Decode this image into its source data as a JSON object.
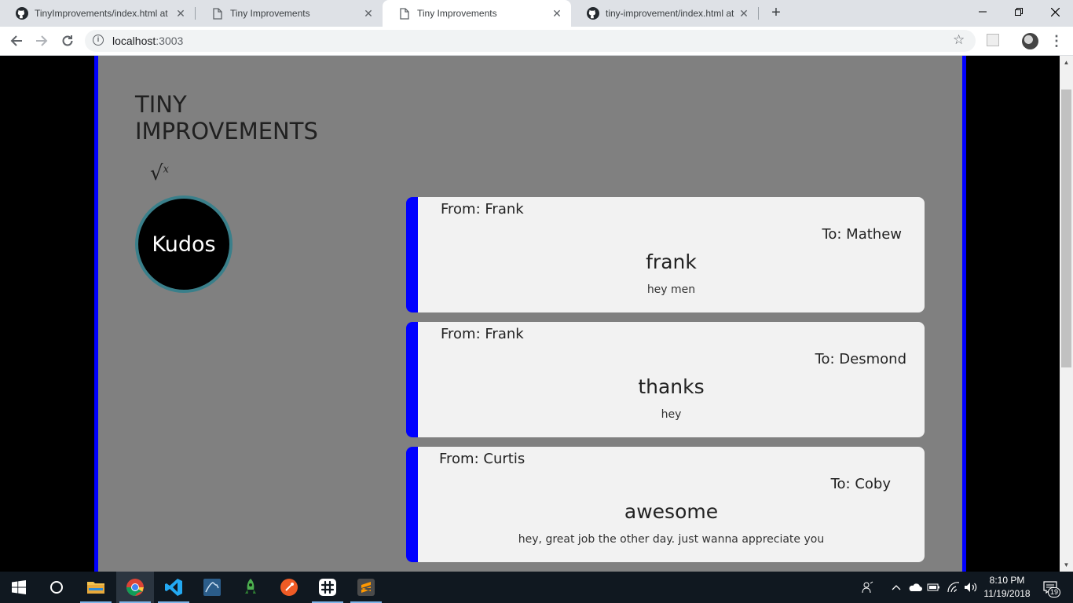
{
  "browser": {
    "tabs": [
      {
        "title": "TinyImprovements/index.html at",
        "icon": "github-icon",
        "active": false
      },
      {
        "title": "Tiny Improvements",
        "icon": "page-icon",
        "active": false
      },
      {
        "title": "Tiny Improvements",
        "icon": "page-icon",
        "active": true
      },
      {
        "title": "tiny-improvement/index.html at",
        "icon": "github-icon",
        "active": false
      }
    ],
    "close_glyph": "✕",
    "new_tab_glyph": "+",
    "url_host": "localhost",
    "url_port": ":3003"
  },
  "app": {
    "title": "TINY IMPROVEMENTS",
    "logo_glyph": "√",
    "logo_superscript": "x",
    "kudos_button_label": "Kudos",
    "colors": {
      "accent": "#0000ff",
      "panel": "#808080",
      "card": "#f2f2f2",
      "kudos_ring": "#3a7f8a"
    }
  },
  "kudos": [
    {
      "from": "From: Frank",
      "to": "To: Mathew",
      "title": "frank",
      "message": "hey men"
    },
    {
      "from": "From: Frank",
      "to": "To: Desmond",
      "title": "thanks",
      "message": "hey"
    },
    {
      "from": "From: Curtis",
      "to": "To: Coby",
      "title": "awesome",
      "message": "hey, great job the other day. just wanna appreciate you"
    }
  ],
  "taskbar": {
    "apps": [
      "start-icon",
      "cortana-icon",
      "file-explorer-icon",
      "chrome-icon",
      "vscode-icon",
      "mysql-workbench-icon",
      "robo3t-icon",
      "postman-icon",
      "slack-icon",
      "sublime-text-icon"
    ],
    "time": "8:10 PM",
    "date": "11/19/2018",
    "notification_count": "19"
  }
}
